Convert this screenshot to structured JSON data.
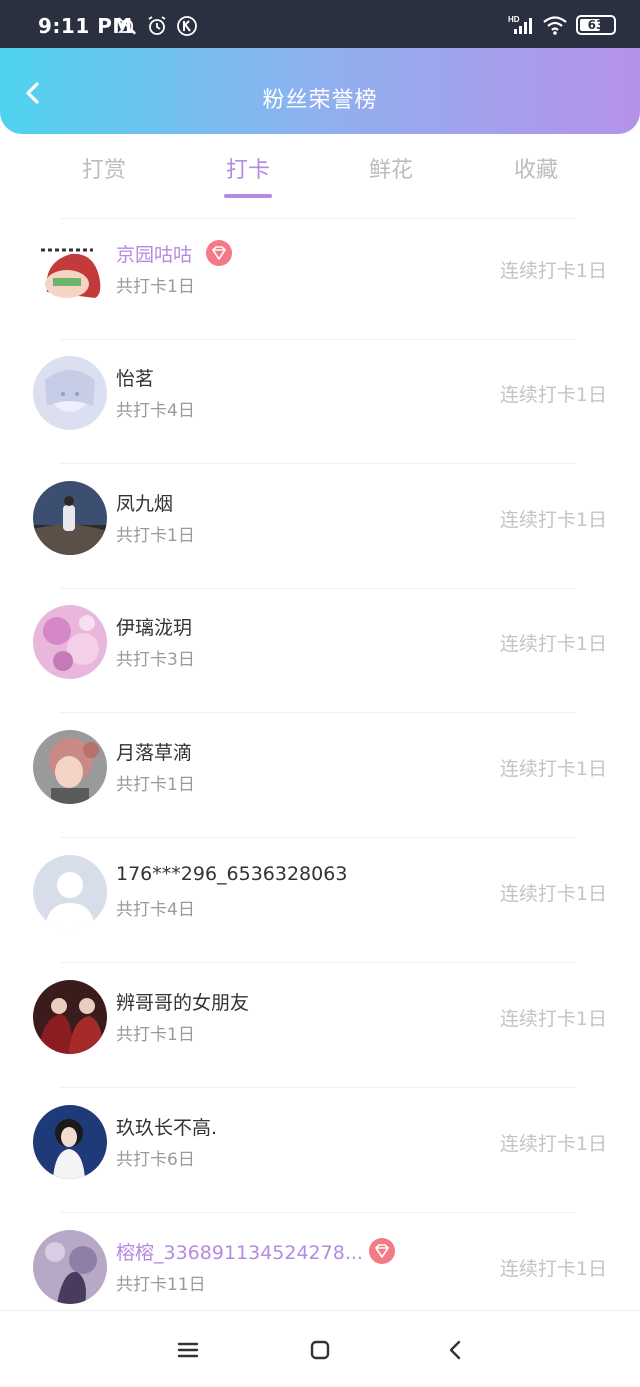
{
  "status_bar": {
    "time": "9:11 PM",
    "icons_left": [
      "bell-off-icon",
      "alarm-icon",
      "k-circle-icon"
    ],
    "icons_right": [
      "hd-signal-icon",
      "wifi-icon",
      "battery-icon"
    ],
    "battery_level": "63",
    "battery_fraction": 0.63
  },
  "header": {
    "title": "粉丝荣誉榜",
    "back_icon": "chevron-left-icon",
    "gradient": [
      "#4fd3ef",
      "#b592ea"
    ]
  },
  "tabs": [
    {
      "label": "打赏",
      "active": false
    },
    {
      "label": "打卡",
      "active": true
    },
    {
      "label": "鲜花",
      "active": false
    },
    {
      "label": "收藏",
      "active": false
    }
  ],
  "accent_color": "#b58ae3",
  "fans": [
    {
      "name": "京园咕咕",
      "vip": true,
      "total": "共打卡1日",
      "streak": "连续打卡1日"
    },
    {
      "name": "怡茗",
      "vip": false,
      "total": "共打卡4日",
      "streak": "连续打卡1日"
    },
    {
      "name": "凤九烟",
      "vip": false,
      "total": "共打卡1日",
      "streak": "连续打卡1日"
    },
    {
      "name": "伊璃泷玥",
      "vip": false,
      "total": "共打卡3日",
      "streak": "连续打卡1日"
    },
    {
      "name": "月落草滴",
      "vip": false,
      "total": "共打卡1日",
      "streak": "连续打卡1日"
    },
    {
      "name": "176***296_6536328063",
      "vip": false,
      "total": "共打卡4日",
      "streak": "连续打卡1日"
    },
    {
      "name": "辨哥哥的女朋友",
      "vip": false,
      "total": "共打卡1日",
      "streak": "连续打卡1日"
    },
    {
      "name": "玖玖长不高.",
      "vip": false,
      "total": "共打卡6日",
      "streak": "连续打卡1日"
    },
    {
      "name": "榕榕_336891134524278...",
      "vip": true,
      "total": "共打卡11日",
      "streak": "连续打卡1日"
    }
  ],
  "nav_bar": {
    "buttons": [
      "menu-icon",
      "home-square-icon",
      "back-triangle-icon"
    ]
  }
}
